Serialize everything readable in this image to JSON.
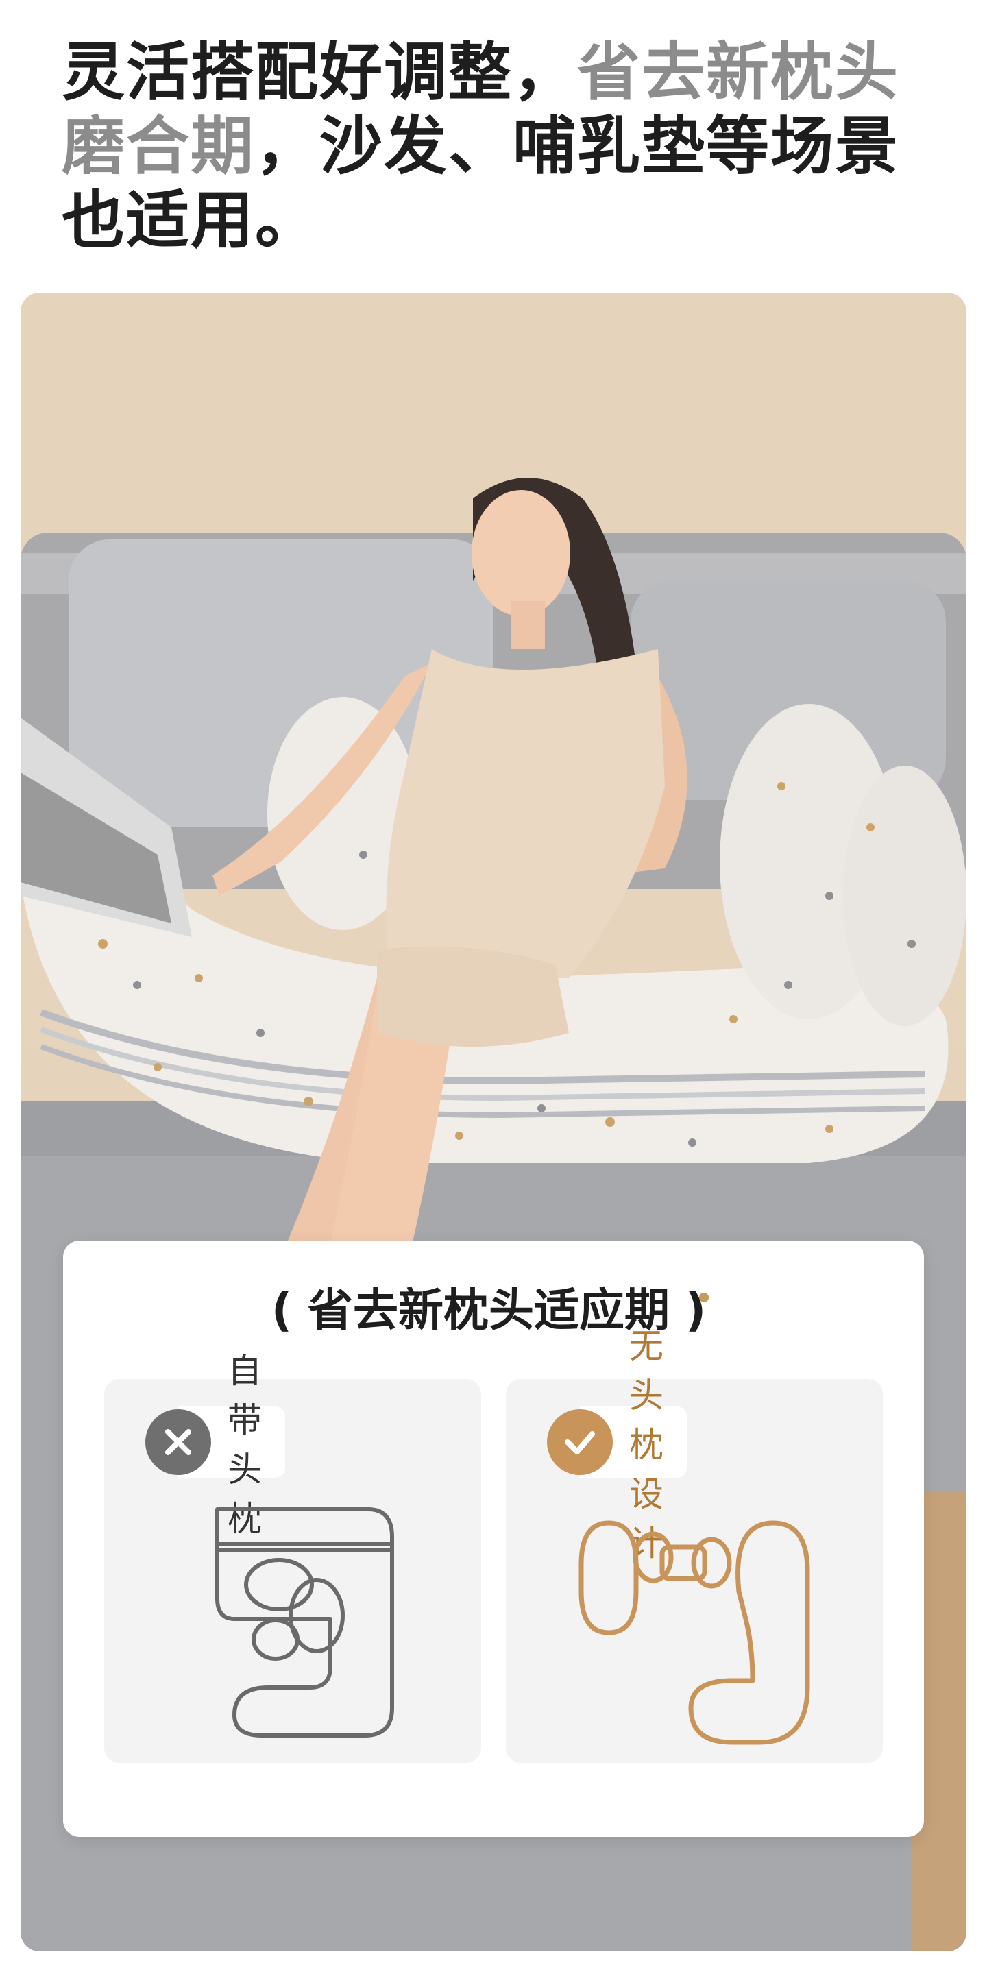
{
  "headline": {
    "part1": "灵活搭配好调整，",
    "part2": "省去新枕头磨合期",
    "part3": "，沙发、哺乳垫等场景也适用。"
  },
  "card": {
    "title": "省去新枕头适应期",
    "left_option": {
      "label": "自带头枕",
      "icon": "x-mark-icon"
    },
    "right_option": {
      "label": "无头枕设计",
      "icon": "check-mark-icon"
    }
  },
  "colors": {
    "headline_dark": "#1e1e1e",
    "headline_muted": "#8c8c8c",
    "gold": "#c8945a",
    "grey_icon": "#6f6f6f",
    "panel_bg": "#f3f3f3"
  }
}
